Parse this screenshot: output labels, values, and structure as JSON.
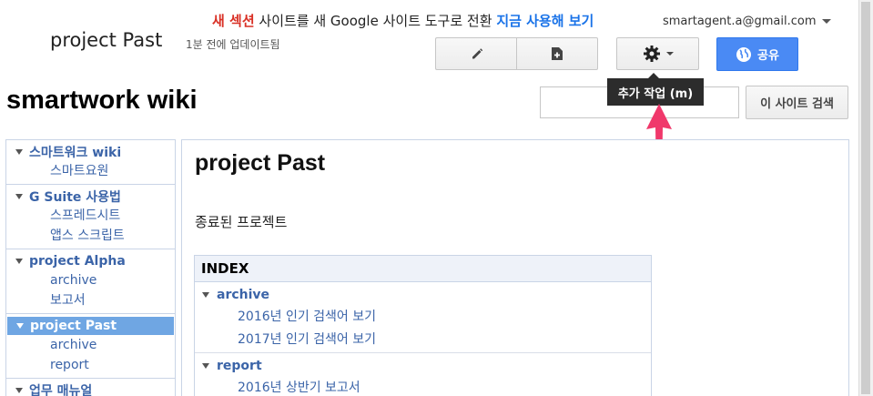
{
  "banner": {
    "new_sites": "새 섹션",
    "message": " 사이트를 새 Google 사이트 도구로 전환 ",
    "cta": "지금 사용해 보기"
  },
  "account": {
    "email": "smartagent.a@gmail.com"
  },
  "header": {
    "page_title": "project Past",
    "last_updated": "1분 전에 업데이트됨",
    "share_label": "공유"
  },
  "toolbar": {
    "edit_icon": "pencil-icon",
    "new_page_icon": "new-page-icon",
    "more_icon": "gear-icon",
    "tooltip": "추가 작업 (m)"
  },
  "site": {
    "name": "smartwork wiki"
  },
  "search": {
    "value": "",
    "button_label": "이 사이트 검색"
  },
  "sidebar": {
    "groups": [
      {
        "label": "스마트워크 wiki",
        "children": [
          "스마트요원"
        ]
      },
      {
        "label": "G Suite 사용법",
        "children": [
          "스프레드시트",
          "앱스 스크립트"
        ]
      },
      {
        "label": "project Alpha",
        "children": [
          "archive",
          "보고서"
        ]
      },
      {
        "label": "project Past",
        "children": [
          "archive",
          "report"
        ],
        "active": true
      },
      {
        "label": "업무 매뉴얼",
        "children": []
      }
    ]
  },
  "main": {
    "heading": "project Past",
    "description": "종료된 프로젝트",
    "index": {
      "title": "INDEX",
      "groups": [
        {
          "label": "archive",
          "children": [
            "2016년 인기 검색어 보기",
            "2017년 인기 검색어 보기"
          ]
        },
        {
          "label": "report",
          "children": [
            "2016년 상반기 보고서"
          ]
        }
      ]
    }
  },
  "colors": {
    "accent": "#4a8af4",
    "link": "#3b64a8",
    "active_nav": "#6fa6e3",
    "annotation_arrow": "#f0386b"
  }
}
